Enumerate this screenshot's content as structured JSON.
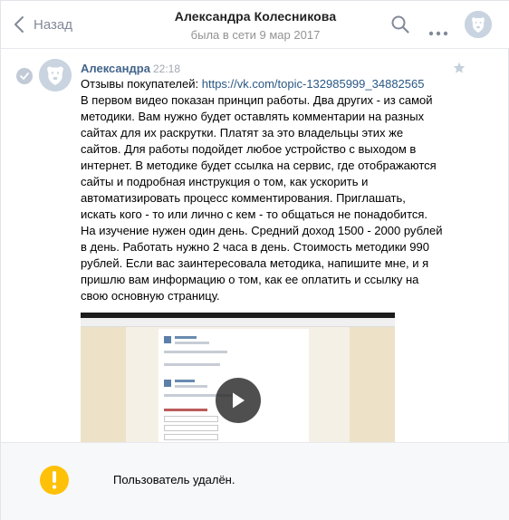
{
  "header": {
    "back_label": "Назад",
    "peer_name": "Александра Колесникова",
    "peer_status": "была в сети 9 мар 2017"
  },
  "message": {
    "author": "Александра",
    "time": "22:18",
    "prefix": "Отзывы покупателей: ",
    "link": "https://vk.com/topic-132985999_34882565",
    "text": "В первом видео показан принцип работы. Два других - из самой методики. Вам нужно будет оставлять комментарии на разных сайтах для их раскрутки. Платят за это владельцы этих же сайтов. Для работы подойдет любое устройство с выходом в интернет. В методике будет ссылка на сервис, где отображаются сайты и подробная инструкция о том, как ускорить и автоматизировать процесс комментирования. Приглашать, искать кого - то или лично с кем - то общаться не понадобится. На изучение нужен один день. Средний доход 1500 - 2000 рублей в день. Работать нужно 2 часа в день. Стоимость методики 990 рублей. Если вас заинтересовала методика, напишите мне, и я пришлю вам информацию о том, как ее оплатить и ссылку на свою основную страницу."
  },
  "footer": {
    "notice": "Пользователь удалён."
  },
  "icons": {
    "back": "chevron-left-icon",
    "search": "search-icon",
    "more": "more-horizontal-icon",
    "star": "star-icon",
    "play": "play-icon",
    "warning": "exclamation-icon",
    "selected": "check-icon"
  },
  "colors": {
    "link": "#2a5885",
    "author": "#42648b",
    "warning": "#ffc107"
  }
}
